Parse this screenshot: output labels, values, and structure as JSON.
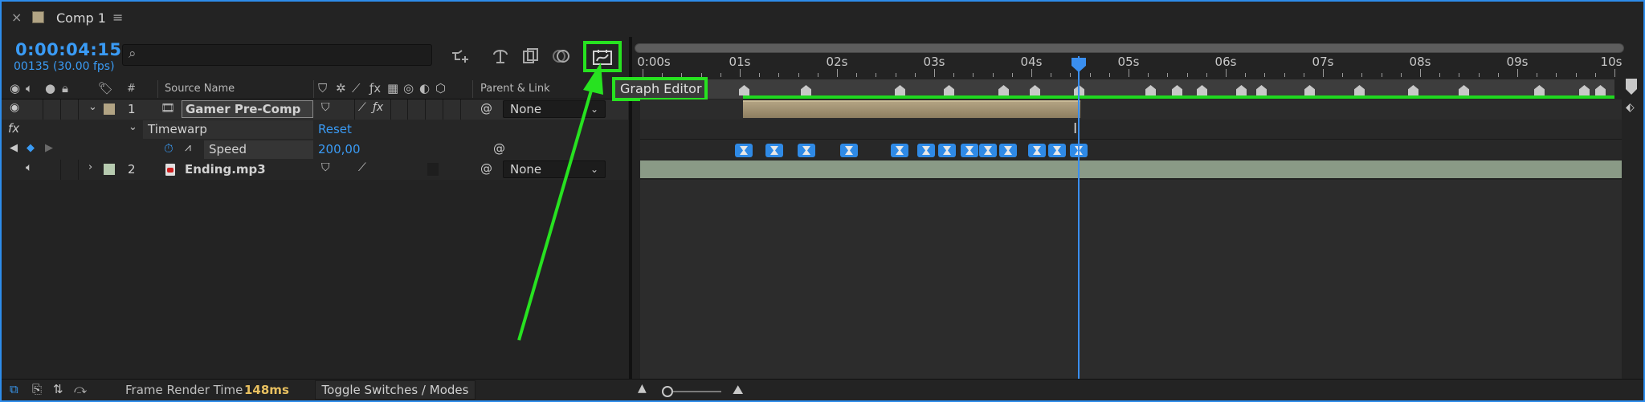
{
  "tab": {
    "close": "×",
    "title": "Comp 1",
    "menu": "≡"
  },
  "timecode": {
    "current": "0:00:04:15",
    "frames": "00135 (30.00 fps)"
  },
  "search": {
    "placeholder": ""
  },
  "columns": {
    "hash": "#",
    "source_name": "Source Name",
    "parent_link": "Parent & Link"
  },
  "layers": [
    {
      "index": "1",
      "name": "Gamer Pre-Comp",
      "parent": "None",
      "color": "#b2a484"
    },
    {
      "index": "2",
      "name": "Ending.mp3",
      "parent": "None",
      "color": "#b7cbb0"
    }
  ],
  "effect": {
    "fx": "fx",
    "name": "Timewarp",
    "reset": "Reset"
  },
  "property": {
    "name": "Speed",
    "value": "200,00"
  },
  "ruler": {
    "ticks": [
      "0:00s",
      "01s",
      "02s",
      "03s",
      "04s",
      "05s",
      "06s",
      "07s",
      "08s",
      "09s",
      "10s"
    ]
  },
  "graph_editor": {
    "label": "Graph Editor"
  },
  "status": {
    "render_label": "Frame Render Time",
    "render_value": "148ms",
    "toggle_label": "Toggle Switches / Modes"
  },
  "colors": {
    "accent": "#3a9bf5",
    "highlight": "#27e220",
    "keyframe": "#2f8ae6"
  }
}
